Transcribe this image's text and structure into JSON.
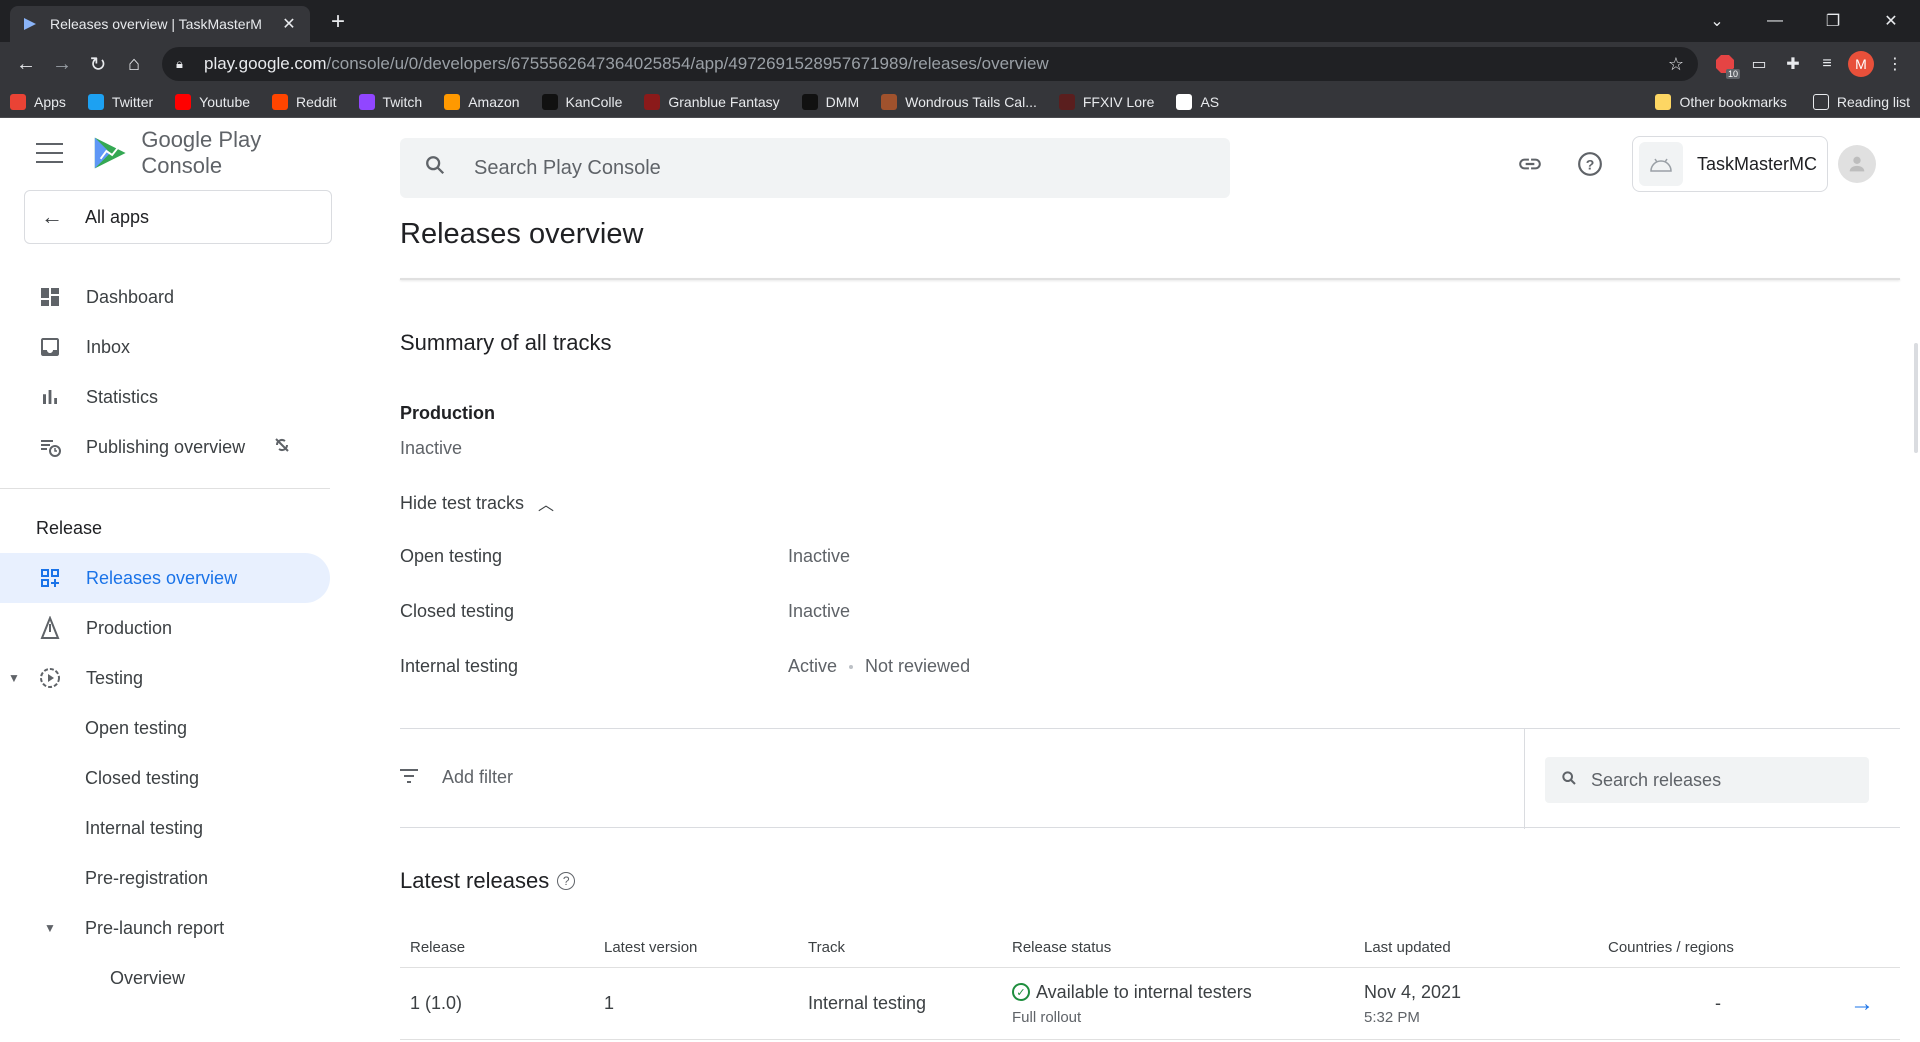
{
  "browser": {
    "tab_title": "Releases overview | TaskMasterM",
    "url_host": "play.google.com",
    "url_path": "/console/u/0/developers/6755562647364025854/app/4972691528957671989/releases/overview",
    "profile_initial": "M",
    "ext_badge": "10",
    "bookmarks": [
      {
        "label": "Apps",
        "icon": "apps-grid-icon",
        "color": "#ea4335"
      },
      {
        "label": "Twitter",
        "icon": "twitter-icon",
        "color": "#1da1f2"
      },
      {
        "label": "Youtube",
        "icon": "youtube-icon",
        "color": "#ff0000"
      },
      {
        "label": "Reddit",
        "icon": "reddit-icon",
        "color": "#ff4500"
      },
      {
        "label": "Twitch",
        "icon": "twitch-icon",
        "color": "#9146ff"
      },
      {
        "label": "Amazon",
        "icon": "amazon-icon",
        "color": "#ff9900"
      },
      {
        "label": "KanColle",
        "icon": "kancolle-icon",
        "color": "#111111"
      },
      {
        "label": "Granblue Fantasy",
        "icon": "granblue-icon",
        "color": "#8b1a1a"
      },
      {
        "label": "DMM",
        "icon": "dmm-icon",
        "color": "#111111"
      },
      {
        "label": "Wondrous Tails Cal...",
        "icon": "wondrous-icon",
        "color": "#a0522d"
      },
      {
        "label": "FFXIV Lore",
        "icon": "ffxiv-icon",
        "color": "#5a1e1e"
      },
      {
        "label": "AS",
        "icon": "as-icon",
        "color": "#ffffff"
      }
    ],
    "other_bookmarks": "Other bookmarks",
    "reading_list": "Reading list"
  },
  "sidebar": {
    "brand": "Google Play Console",
    "all_apps": "All apps",
    "items": [
      {
        "label": "Dashboard",
        "icon": "dashboard-icon"
      },
      {
        "label": "Inbox",
        "icon": "inbox-icon"
      },
      {
        "label": "Statistics",
        "icon": "bar-chart-icon"
      },
      {
        "label": "Publishing overview",
        "icon": "publishing-icon"
      }
    ],
    "release_section": "Release",
    "release_items": {
      "releases_overview": "Releases overview",
      "production": "Production",
      "testing": "Testing",
      "open_testing": "Open testing",
      "closed_testing": "Closed testing",
      "internal_testing": "Internal testing",
      "pre_registration": "Pre-registration",
      "pre_launch_report": "Pre-launch report",
      "overview": "Overview"
    }
  },
  "header": {
    "search_placeholder": "Search Play Console",
    "account_name": "TaskMasterMC"
  },
  "main": {
    "title": "Releases overview",
    "summary_title": "Summary of all tracks",
    "production_label": "Production",
    "production_status": "Inactive",
    "hide_tracks": "Hide test tracks",
    "tracks": [
      {
        "name": "Open testing",
        "status": "Inactive",
        "extra": ""
      },
      {
        "name": "Closed testing",
        "status": "Inactive",
        "extra": ""
      },
      {
        "name": "Internal testing",
        "status": "Active",
        "extra": "Not reviewed"
      }
    ],
    "add_filter": "Add filter",
    "search_releases": "Search releases",
    "latest_title": "Latest releases",
    "table": {
      "headers": [
        "Release",
        "Latest version",
        "Track",
        "Release status",
        "Last updated",
        "Countries / regions"
      ],
      "rows": [
        {
          "release": "1 (1.0)",
          "version": "1",
          "track": "Internal testing",
          "status": "Available to internal testers",
          "status_sub": "Full rollout",
          "updated": "Nov 4, 2021",
          "updated_time": "5:32 PM",
          "countries": "-"
        }
      ]
    }
  }
}
